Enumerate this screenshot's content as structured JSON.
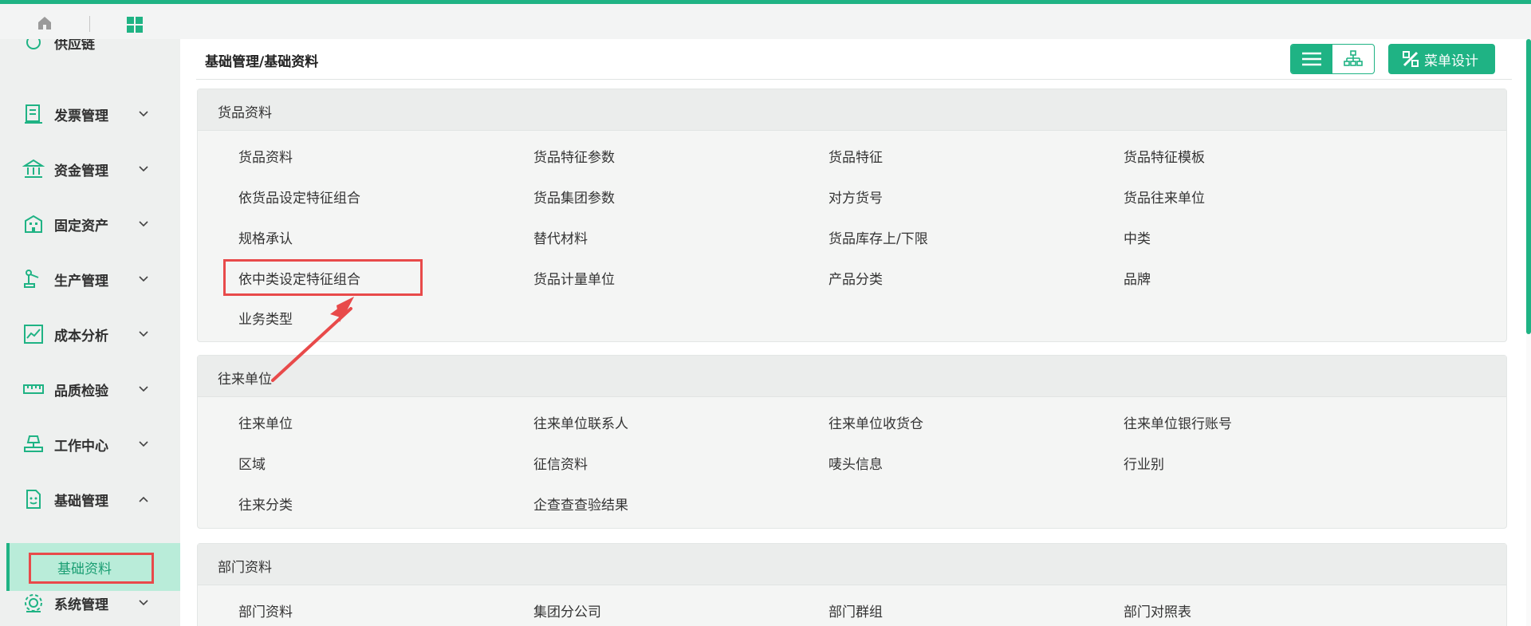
{
  "sidebar": {
    "partial_top_label": "供应链",
    "items": [
      {
        "label": "发票管理",
        "icon": "invoice-icon",
        "expanded": false
      },
      {
        "label": "资金管理",
        "icon": "bank-icon",
        "expanded": false
      },
      {
        "label": "固定资产",
        "icon": "building-icon",
        "expanded": false
      },
      {
        "label": "生产管理",
        "icon": "robot-arm-icon",
        "expanded": false
      },
      {
        "label": "成本分析",
        "icon": "chart-icon",
        "expanded": false
      },
      {
        "label": "品质检验",
        "icon": "ruler-icon",
        "expanded": false
      },
      {
        "label": "工作中心",
        "icon": "workstation-icon",
        "expanded": false
      },
      {
        "label": "基础管理",
        "icon": "document-icon",
        "expanded": true
      },
      {
        "label": "系统管理",
        "icon": "gear-icon",
        "expanded": false
      }
    ],
    "active_sub_item": "基础资料"
  },
  "header": {
    "breadcrumb": "基础管理/基础资料",
    "menu_design_label": "菜单设计"
  },
  "sections": [
    {
      "title": "货品资料",
      "links": [
        "货品资料",
        "货品特征参数",
        "货品特征",
        "货品特征模板",
        "依货品设定特征组合",
        "货品集团参数",
        "对方货号",
        "货品往来单位",
        "规格承认",
        "替代材料",
        "货品库存上/下限",
        "中类",
        "依中类设定特征组合",
        "货品计量单位",
        "产品分类",
        "品牌",
        "业务类型"
      ]
    },
    {
      "title": "往来单位",
      "links": [
        "往来单位",
        "往来单位联系人",
        "往来单位收货仓",
        "往来单位银行账号",
        "区域",
        "征信资料",
        "唛头信息",
        "行业别",
        "往来分类",
        "企查查查验结果"
      ]
    },
    {
      "title": "部门资料",
      "links": [
        "部门资料",
        "集团分公司",
        "部门群组",
        "部门对照表"
      ]
    }
  ],
  "colors": {
    "accent": "#1fb384",
    "highlight_red": "#e84a4a",
    "active_sub_bg": "#b9ecd9"
  }
}
